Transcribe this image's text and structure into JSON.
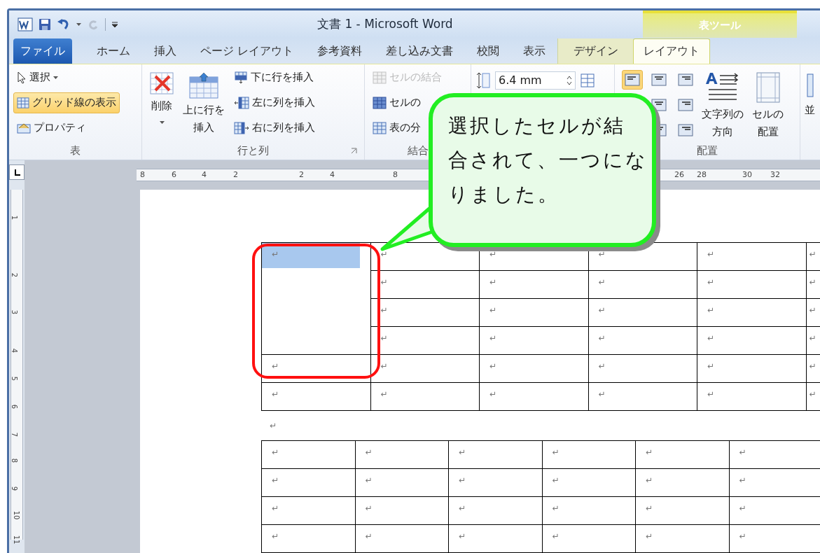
{
  "window": {
    "title": "文書 1 - Microsoft Word",
    "contextual_header": "表ツール",
    "redo": {
      "disabled": true
    }
  },
  "tabs": [
    {
      "label": "ファイル",
      "kind": "file",
      "selected": false
    },
    {
      "label": "ホーム",
      "kind": "normal",
      "selected": false
    },
    {
      "label": "挿入",
      "kind": "normal",
      "selected": false
    },
    {
      "label": "ページ レイアウト",
      "kind": "normal",
      "selected": false
    },
    {
      "label": "参考資料",
      "kind": "normal",
      "selected": false
    },
    {
      "label": "差し込み文書",
      "kind": "normal",
      "selected": false
    },
    {
      "label": "校閲",
      "kind": "normal",
      "selected": false
    },
    {
      "label": "表示",
      "kind": "normal",
      "selected": false
    },
    {
      "label": "デザイン",
      "kind": "contextual",
      "selected": false
    },
    {
      "label": "レイアウト",
      "kind": "contextual",
      "selected": true
    }
  ],
  "ribbon": {
    "groups": [
      {
        "label": "表",
        "launcher": false,
        "items": [
          {
            "kind": "small",
            "label": "選択",
            "dropdown": true,
            "selected": false,
            "disabled": false
          },
          {
            "kind": "small",
            "label": "グリッド線の表示",
            "dropdown": false,
            "selected": true,
            "disabled": false
          },
          {
            "kind": "small",
            "label": "プロパティ",
            "dropdown": false,
            "selected": false,
            "disabled": false
          }
        ]
      },
      {
        "label": "行と列",
        "launcher": true,
        "items": [
          {
            "kind": "large",
            "label_lines": [
              "削除"
            ],
            "dropdown": true,
            "selected": false,
            "disabled": false
          },
          {
            "kind": "large",
            "label_lines": [
              "上に行を",
              "挿入"
            ],
            "dropdown": false,
            "selected": false,
            "disabled": false
          },
          {
            "kind": "small",
            "label": "下に行を挿入",
            "dropdown": false,
            "selected": false,
            "disabled": false
          },
          {
            "kind": "small",
            "label": "左に列を挿入",
            "dropdown": false,
            "selected": false,
            "disabled": false
          },
          {
            "kind": "small",
            "label": "右に列を挿入",
            "dropdown": false,
            "selected": false,
            "disabled": false
          }
        ]
      },
      {
        "label": "結合",
        "launcher": false,
        "items": [
          {
            "kind": "small",
            "label": "セルの結合",
            "dropdown": false,
            "selected": false,
            "disabled": true
          },
          {
            "kind": "small",
            "label": "セルの",
            "dropdown": false,
            "selected": false,
            "disabled": false
          },
          {
            "kind": "small",
            "label": "表の分",
            "dropdown": false,
            "selected": false,
            "disabled": false
          }
        ]
      },
      {
        "kind": "size",
        "items": [
          {
            "kind": "spinner",
            "value": "6.4 mm"
          }
        ]
      },
      {
        "label": "配置",
        "launcher": false,
        "items": [
          {
            "kind": "align",
            "rows": [
              [
                {
                  "selected": true
                },
                {
                  "selected": false
                },
                {
                  "selected": false
                }
              ],
              [
                {
                  "selected": false
                },
                {
                  "selected": false
                }
              ],
              [
                {
                  "selected": false
                },
                {
                  "selected": false
                }
              ]
            ]
          },
          {
            "kind": "large",
            "label_lines": [
              "文字列の",
              "方向"
            ],
            "dropdown": false,
            "selected": false,
            "disabled": false
          },
          {
            "kind": "large",
            "label_lines": [
              "セルの",
              "配置"
            ],
            "dropdown": false,
            "selected": false,
            "disabled": false
          }
        ]
      },
      {
        "kind": "cut",
        "items": [
          {
            "kind": "large",
            "label_lines": [
              "並"
            ],
            "dropdown": false,
            "selected": false,
            "disabled": false
          }
        ]
      }
    ]
  },
  "ruler": {
    "horizontal": [
      "8",
      "6",
      "4",
      "2",
      "2",
      "4",
      "8",
      "26",
      "28",
      "30",
      "32"
    ],
    "vertical": [
      "1",
      "2",
      "3",
      "4",
      "5",
      "6",
      "7",
      "8",
      "9",
      "10",
      "11"
    ]
  },
  "document": {
    "tables": [
      {
        "rows": [
          [
            {
              "text": "↵",
              "selected": true,
              "rowspan": 4
            },
            {
              "text": "↵",
              "selected": false
            },
            {
              "text": "↵",
              "selected": false
            },
            {
              "text": "↵",
              "selected": false
            },
            {
              "text": "↵",
              "selected": false
            },
            {
              "text": "↵",
              "selected": false
            }
          ],
          [
            {
              "text": "↵",
              "selected": false
            },
            {
              "text": "↵",
              "selected": false
            },
            {
              "text": "↵",
              "selected": false
            },
            {
              "text": "↵",
              "selected": false
            },
            {
              "text": "↵",
              "selected": false
            }
          ],
          [
            {
              "text": "↵",
              "selected": false
            },
            {
              "text": "↵",
              "selected": false
            },
            {
              "text": "↵",
              "selected": false
            },
            {
              "text": "↵",
              "selected": false
            },
            {
              "text": "↵",
              "selected": false
            }
          ],
          [
            {
              "text": "↵",
              "selected": false
            },
            {
              "text": "↵",
              "selected": false
            },
            {
              "text": "↵",
              "selected": false
            },
            {
              "text": "↵",
              "selected": false
            },
            {
              "text": "↵",
              "selected": false
            }
          ],
          [
            {
              "text": "↵",
              "selected": false
            },
            {
              "text": "↵",
              "selected": false
            },
            {
              "text": "↵",
              "selected": false
            },
            {
              "text": "↵",
              "selected": false
            },
            {
              "text": "↵",
              "selected": false
            },
            {
              "text": "↵",
              "selected": false
            }
          ],
          [
            {
              "text": "↵",
              "selected": false
            },
            {
              "text": "↵",
              "selected": false
            },
            {
              "text": "↵",
              "selected": false
            },
            {
              "text": "↵",
              "selected": false
            },
            {
              "text": "↵",
              "selected": false
            },
            {
              "text": "↵",
              "selected": false
            }
          ]
        ]
      },
      {
        "paragraph_mark": "↵"
      },
      {
        "rows": [
          [
            {
              "text": "↵",
              "selected": false
            },
            {
              "text": "↵",
              "selected": false
            },
            {
              "text": "↵",
              "selected": false
            },
            {
              "text": "↵",
              "selected": false
            },
            {
              "text": "↵",
              "selected": false
            },
            {
              "text": "↵",
              "selected": false
            }
          ],
          [
            {
              "text": "↵",
              "selected": false
            },
            {
              "text": "↵",
              "selected": false
            },
            {
              "text": "↵",
              "selected": false
            },
            {
              "text": "↵",
              "selected": false
            },
            {
              "text": "↵",
              "selected": false
            },
            {
              "text": "↵",
              "selected": false
            }
          ],
          [
            {
              "text": "↵",
              "selected": false
            },
            {
              "text": "↵",
              "selected": false
            },
            {
              "text": "↵",
              "selected": false
            },
            {
              "text": "↵",
              "selected": false
            },
            {
              "text": "↵",
              "selected": false
            },
            {
              "text": "↵",
              "selected": false
            }
          ],
          [
            {
              "text": "↵",
              "selected": false
            },
            {
              "text": "↵",
              "selected": false
            },
            {
              "text": "↵",
              "selected": false
            },
            {
              "text": "↵",
              "selected": false
            },
            {
              "text": "↵",
              "selected": false
            },
            {
              "text": "↵",
              "selected": false
            }
          ]
        ]
      }
    ]
  },
  "callout": {
    "lines": [
      "選択したセルが結",
      "合されて、一つにな",
      "りました。"
    ],
    "highlight_frame": true
  }
}
